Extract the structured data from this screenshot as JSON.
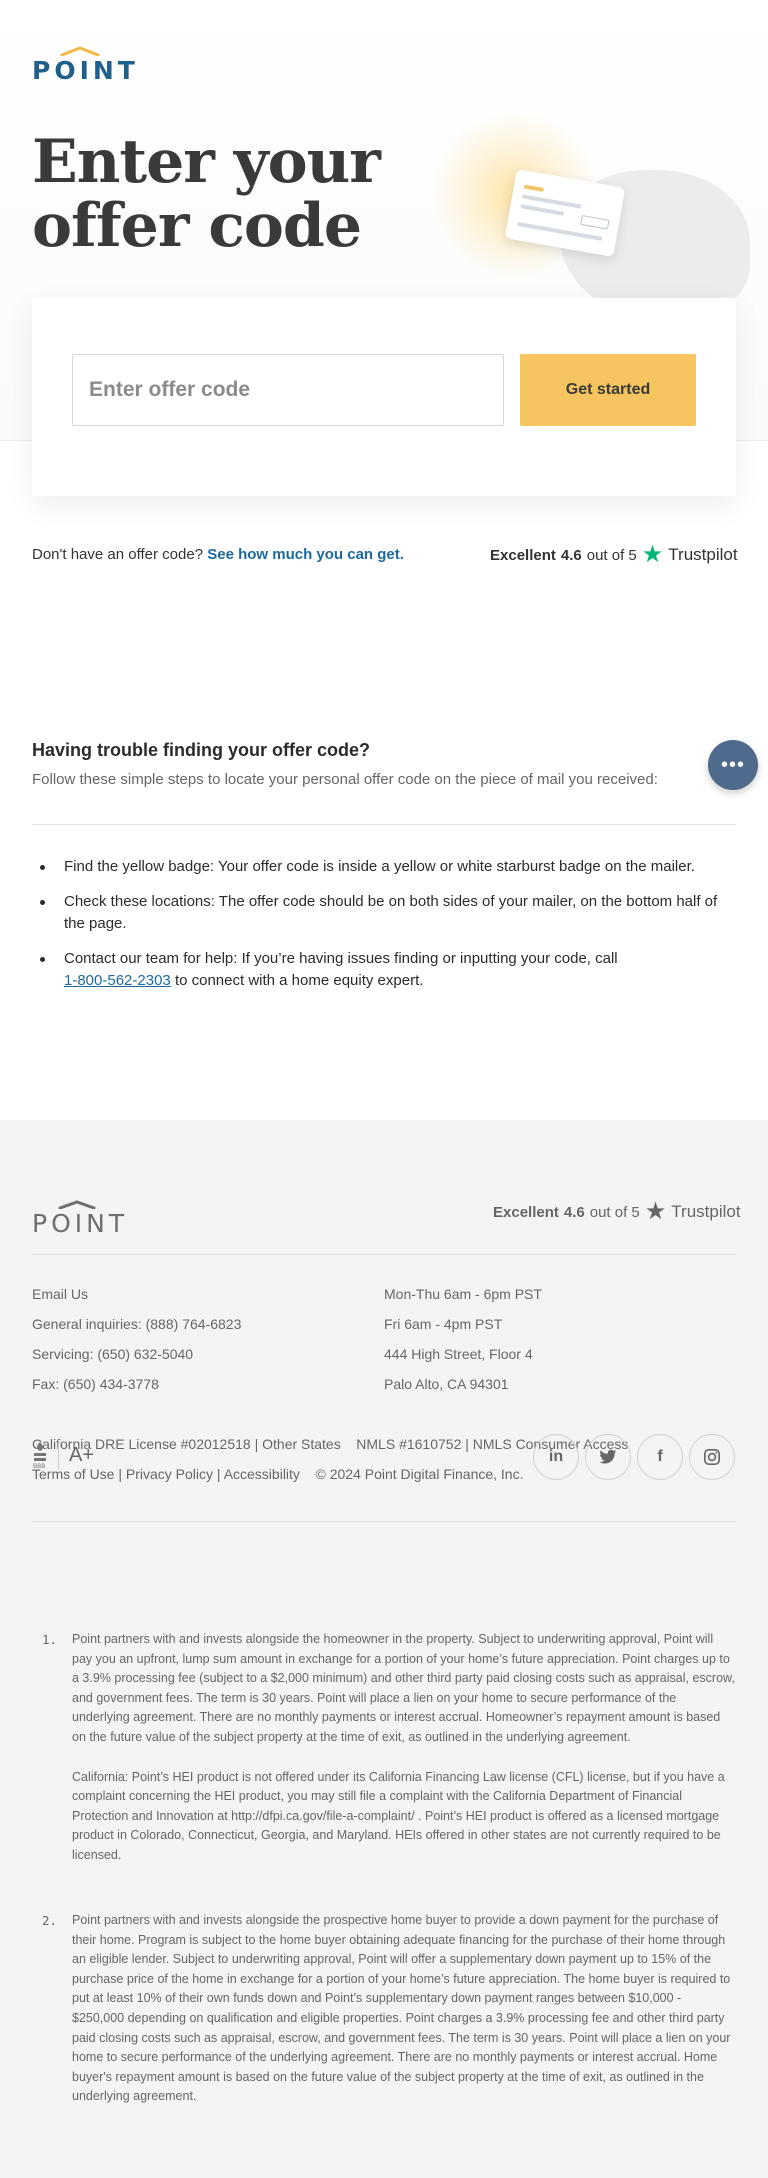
{
  "brand": {
    "logo_text": "POINT",
    "footer_logo_text": "POINT"
  },
  "hero": {
    "title": "Enter your offer code"
  },
  "form": {
    "input_placeholder": "Enter offer code",
    "input_value": "",
    "button_label": "Get started"
  },
  "no_code": {
    "text": "Don't have an offer code?",
    "link": "See how much you can get."
  },
  "trustpilot": {
    "rating_label": "Excellent",
    "score": "4.6",
    "out_of": "out of 5",
    "brand": "Trustpilot",
    "star_color": "#00b67a"
  },
  "trouble": {
    "heading": "Having trouble finding your offer code?",
    "subheading": "Follow these simple steps to locate your personal offer code on the piece of mail you received:",
    "steps": [
      {
        "text": "Find the yellow badge: Your offer code is inside a yellow or white starburst badge on the mailer."
      },
      {
        "text": "Check these locations: The offer code should be on both sides of your mailer, on the bottom half of the page."
      },
      {
        "text_before": "Contact our team for help: If you’re having issues finding or inputting your code, call",
        "phone": "1-800-562-2303",
        "text_after": "to connect with a home equity expert."
      }
    ]
  },
  "chat": {
    "icon": "ellipsis-icon",
    "glyph": "•••"
  },
  "footer": {
    "contact": [
      "Email Us",
      "General inquiries: (888) 764-6823",
      "Servicing: (650) 632-5040",
      "Fax: (650) 434-3778"
    ],
    "hours_address": [
      "Mon-Thu 6am - 6pm PST",
      "Fri 6am - 4pm PST",
      "444 High Street, Floor 4",
      "Palo Alto, CA 94301"
    ],
    "license_line": {
      "dre": "California DRE License #02012518",
      "sep": "|",
      "other_states": "Other States",
      "nmls": "NMLS #1610752",
      "nmls_access": "NMLS Consumer Access"
    },
    "links_line": {
      "terms": "Terms of Use",
      "privacy": "Privacy Policy",
      "accessibility": "Accessibility",
      "copyright": "© 2024 Point Digital Finance, Inc."
    },
    "bbb": {
      "label": "BBB",
      "grade": "A+"
    },
    "social": [
      {
        "name": "linkedin-icon",
        "glyph": "in"
      },
      {
        "name": "twitter-icon",
        "glyph": "🐦"
      },
      {
        "name": "facebook-icon",
        "glyph": "f"
      },
      {
        "name": "instagram-icon",
        "glyph": "◎"
      }
    ],
    "footnotes": [
      {
        "num": "1.",
        "paragraphs": [
          "Point partners with and invests alongside the homeowner in the property. Subject to underwriting approval, Point will pay you an upfront, lump sum amount in exchange for a portion of your home’s future appreciation. Point charges up to a 3.9% processing fee (subject to a $2,000 minimum) and other third party paid closing costs such as appraisal, escrow, and government fees. The term is 30 years. Point will place a lien on your home to secure performance of the underlying agreement. There are no monthly payments or interest accrual. Homeowner’s repayment amount is based on the future value of the subject property at the time of exit, as outlined in the underlying agreement.",
          "California: Point’s HEI product is not offered under its California Financing Law license (CFL) license, but if you have a complaint concerning the HEI product, you may still file a complaint with the California Department of Financial Protection and Innovation at http://dfpi.ca.gov/file-a-complaint/ . Point’s HEI product is offered as a licensed mortgage product in Colorado, Connecticut, Georgia, and Maryland. HEIs offered in other states are not currently required to be licensed."
        ]
      },
      {
        "num": "2.",
        "paragraphs": [
          "Point partners with and invests alongside the prospective home buyer to provide a down payment for the purchase of their home. Program is subject to the home buyer obtaining adequate financing for the purchase of their home through an eligible lender. Subject to underwriting approval, Point will offer a supplementary down payment up to 15% of the purchase price of the home in exchange for a portion of your home’s future appreciation. The home buyer is required to put at least 10% of their own funds down and Point’s supplementary down payment ranges between $10,000 - $250,000 depending on qualification and eligible properties. Point charges a 3.9% processing fee and other third party paid closing costs such as appraisal, escrow, and government fees. The term is 30 years. Point will place a lien on your home to secure performance of the underlying agreement. There are no monthly payments or interest accrual. Home buyer's repayment amount is based on the future value of the subject property at the time of exit, as outlined in the underlying agreement."
        ]
      }
    ]
  }
}
